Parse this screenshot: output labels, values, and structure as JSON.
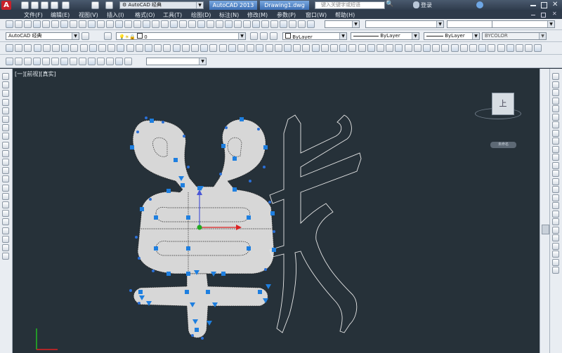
{
  "titlebar": {
    "app_logo": "A",
    "workspace": "AutoCAD 经典",
    "product": "AutoCAD 2013",
    "document": "Drawing1.dwg",
    "search_placeholder": "键入关键字或短语",
    "login": "登录"
  },
  "menu": [
    "文件(F)",
    "编辑(E)",
    "视图(V)",
    "插入(I)",
    "格式(O)",
    "工具(T)",
    "绘图(D)",
    "标注(N)",
    "修改(M)",
    "参数(P)",
    "窗口(W)",
    "帮助(H)"
  ],
  "toolbar2": {
    "workspace_combo": "AutoCAD 经典",
    "layer_combo": "0",
    "color_combo": "ByLayer",
    "linetype_combo": "ByLayer",
    "lineweight_combo": "ByLayer",
    "plotstyle_combo": "BYCOLOR"
  },
  "viewport": {
    "label": "[一][前视][真实]",
    "viewcube_face": "上",
    "viewcube_menu": "未命名"
  },
  "colors": {
    "canvas": "#263139",
    "grip": "#1e7fe0",
    "shape_fill": "#d7d7d7",
    "ucs_x": "#d22",
    "ucs_y": "#2b2"
  }
}
